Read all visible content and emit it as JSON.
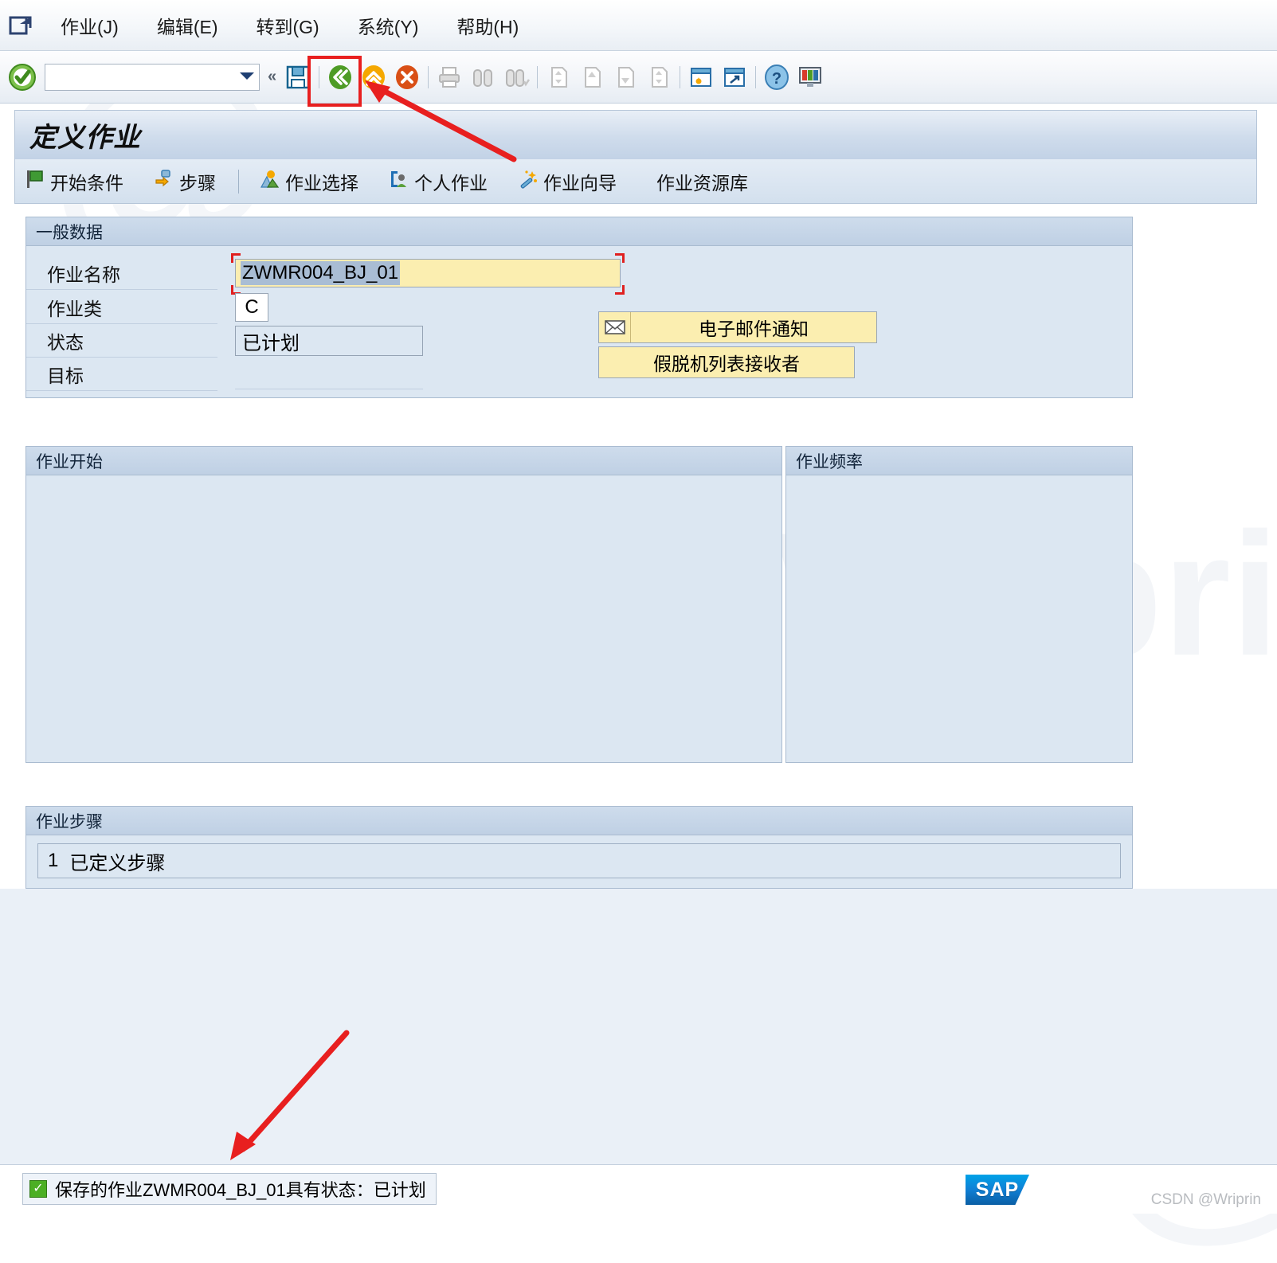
{
  "menu": {
    "system_icon": "window-exit-icon",
    "items": [
      {
        "label": "作业(J)",
        "name": "menu-job"
      },
      {
        "label": "编辑(E)",
        "name": "menu-edit"
      },
      {
        "label": "转到(G)",
        "name": "menu-goto"
      },
      {
        "label": "系统(Y)",
        "name": "menu-system"
      },
      {
        "label": "帮助(H)",
        "name": "menu-help"
      }
    ]
  },
  "toolbar": {
    "enter_icon": "green-check-icon",
    "command_value": "",
    "command_placeholder": "",
    "dropdown_icon": "chevron-down-icon",
    "collapse_icon": "double-chevron-left-icon",
    "buttons": [
      {
        "name": "save-button",
        "icon": "floppy-save-icon",
        "enabled": true
      },
      {
        "name": "back-button",
        "icon": "green-back-icon",
        "enabled": true
      },
      {
        "name": "exit-button",
        "icon": "yellow-up-icon",
        "enabled": true
      },
      {
        "name": "cancel-button",
        "icon": "red-cancel-icon",
        "enabled": true
      },
      {
        "name": "print-button",
        "icon": "printer-icon",
        "enabled": false
      },
      {
        "name": "find-button",
        "icon": "binoculars-icon",
        "enabled": false
      },
      {
        "name": "find-next-button",
        "icon": "binoculars-plus-icon",
        "enabled": false
      },
      {
        "name": "first-page-button",
        "icon": "page-first-icon",
        "enabled": false
      },
      {
        "name": "prev-page-button",
        "icon": "page-up-icon",
        "enabled": false
      },
      {
        "name": "next-page-button",
        "icon": "page-down-icon",
        "enabled": false
      },
      {
        "name": "last-page-button",
        "icon": "page-last-icon",
        "enabled": false
      },
      {
        "name": "create-session-button",
        "icon": "new-session-icon",
        "enabled": true
      },
      {
        "name": "create-shortcut-button",
        "icon": "shortcut-icon",
        "enabled": true
      },
      {
        "name": "help-button",
        "icon": "question-help-icon",
        "enabled": true
      },
      {
        "name": "customize-button",
        "icon": "layout-menu-icon",
        "enabled": true
      }
    ]
  },
  "screen": {
    "title": "定义作业",
    "actions": [
      {
        "label": "开始条件",
        "icon": "green-flag-icon",
        "name": "action-start-condition"
      },
      {
        "label": "步骤",
        "icon": "steps-arrow-icon",
        "name": "action-steps"
      },
      {
        "label": "作业选择",
        "icon": "job-selection-icon",
        "name": "action-job-selection"
      },
      {
        "label": "个人作业",
        "icon": "own-jobs-icon",
        "name": "action-own-jobs"
      },
      {
        "label": "作业向导",
        "icon": "magic-wand-icon",
        "name": "action-job-wizard"
      },
      {
        "label": "作业资源库",
        "icon": "",
        "name": "action-job-repository"
      }
    ]
  },
  "general_data": {
    "header": "一般数据",
    "fields": [
      {
        "label": "作业名称",
        "value": "ZWMR004_BJ_01",
        "name": "job-name"
      },
      {
        "label": "作业类",
        "value": "C",
        "name": "job-class"
      },
      {
        "label": "状态",
        "value": "已计划",
        "name": "job-status"
      },
      {
        "label": "目标",
        "value": "",
        "name": "job-target"
      }
    ],
    "side_buttons": [
      {
        "label": "电子邮件通知",
        "icon": "envelope-icon",
        "name": "email-notification-button"
      },
      {
        "label": "假脱机列表接收者",
        "icon": "",
        "name": "spool-recipient-button"
      }
    ]
  },
  "job_start": {
    "header": "作业开始"
  },
  "job_frequency": {
    "header": "作业频率"
  },
  "job_steps": {
    "header": "作业步骤",
    "rows": [
      {
        "number": "1",
        "text": "已定义步骤"
      }
    ]
  },
  "status_bar": {
    "icon": "green-check-icon",
    "message": "保存的作业ZWMR004_BJ_01具有状态：已计划",
    "brand": "SAP",
    "watermark": "CSDN @Wriprin"
  },
  "colors": {
    "accent_blue": "#1f6fb5",
    "panel_bg": "#dce7f2",
    "field_yellow": "#fbeeb0",
    "annotation_red": "#e81f1f",
    "status_green": "#4caf24"
  }
}
